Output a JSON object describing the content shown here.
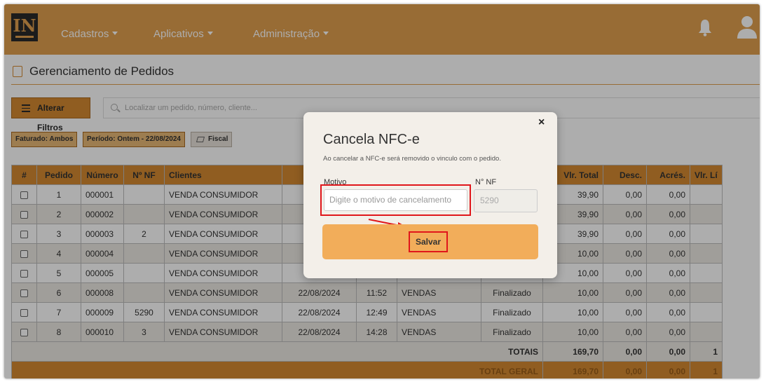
{
  "header": {
    "logo": "IN",
    "menus": [
      "Cadastros",
      "Aplicativos",
      "Administração"
    ],
    "icons": [
      "bell-icon",
      "user-icon"
    ],
    "accent": "#e0a04f"
  },
  "page": {
    "title": "Gerenciamento de Pedidos",
    "filters_button": "Alterar Filtros",
    "search_placeholder": "Localizar um pedido, número, cliente...",
    "chips": {
      "faturado": "Faturado: Ambos",
      "periodo": "Período: Ontem - 22/08/2024",
      "fiscal": "Fiscal"
    }
  },
  "table": {
    "headers": [
      "#",
      "Pedido",
      "Número",
      "Nº NF",
      "Clientes",
      "",
      "",
      "",
      "",
      "Vlr. Total",
      "Desc.",
      "Acrés.",
      "Vlr. Lí"
    ],
    "rows": [
      {
        "pedido": "1",
        "numero": "000001",
        "nf": "",
        "cliente": "VENDA CONSUMIDOR",
        "data": "",
        "hora": "",
        "vendedor": "",
        "status": "",
        "total": "39,90",
        "desc": "0,00",
        "acres": "0,00"
      },
      {
        "pedido": "2",
        "numero": "000002",
        "nf": "",
        "cliente": "VENDA CONSUMIDOR",
        "data": "",
        "hora": "",
        "vendedor": "",
        "status": "",
        "total": "39,90",
        "desc": "0,00",
        "acres": "0,00"
      },
      {
        "pedido": "3",
        "numero": "000003",
        "nf": "2",
        "cliente": "VENDA CONSUMIDOR",
        "data": "",
        "hora": "",
        "vendedor": "",
        "status": "",
        "total": "39,90",
        "desc": "0,00",
        "acres": "0,00"
      },
      {
        "pedido": "4",
        "numero": "000004",
        "nf": "",
        "cliente": "VENDA CONSUMIDOR",
        "data": "",
        "hora": "",
        "vendedor": "",
        "status": "",
        "total": "10,00",
        "desc": "0,00",
        "acres": "0,00"
      },
      {
        "pedido": "5",
        "numero": "000005",
        "nf": "",
        "cliente": "VENDA CONSUMIDOR",
        "data": "",
        "hora": "",
        "vendedor": "",
        "status": "",
        "total": "10,00",
        "desc": "0,00",
        "acres": "0,00"
      },
      {
        "pedido": "6",
        "numero": "000008",
        "nf": "",
        "cliente": "VENDA CONSUMIDOR",
        "data": "22/08/2024",
        "hora": "11:52",
        "vendedor": "VENDAS",
        "status": "Finalizado",
        "total": "10,00",
        "desc": "0,00",
        "acres": "0,00"
      },
      {
        "pedido": "7",
        "numero": "000009",
        "nf": "5290",
        "cliente": "VENDA CONSUMIDOR",
        "data": "22/08/2024",
        "hora": "12:49",
        "vendedor": "VENDAS",
        "status": "Finalizado",
        "total": "10,00",
        "desc": "0,00",
        "acres": "0,00"
      },
      {
        "pedido": "8",
        "numero": "000010",
        "nf": "3",
        "cliente": "VENDA CONSUMIDOR",
        "data": "22/08/2024",
        "hora": "14:28",
        "vendedor": "VENDAS",
        "status": "Finalizado",
        "total": "10,00",
        "desc": "0,00",
        "acres": "0,00"
      }
    ],
    "totais": {
      "label": "TOTAIS",
      "total": "169,70",
      "desc": "0,00",
      "acres": "0,00",
      "liq": "1"
    },
    "geral": {
      "label": "TOTAL GERAL",
      "total": "169,70",
      "desc": "0,00",
      "acres": "0,00",
      "liq": "1"
    }
  },
  "modal": {
    "close": "×",
    "title": "Cancela NFC-e",
    "subtitle": "Ao cancelar a NFC-e será removido o vinculo com o pedido.",
    "motivo_label": "Motivo",
    "motivo_placeholder": "Digite o motivo de cancelamento",
    "nf_label": "N° NF",
    "nf_value": "5290",
    "save": "Salvar",
    "highlight_color": "#e0161b",
    "button_color": "#f2ad5a"
  }
}
